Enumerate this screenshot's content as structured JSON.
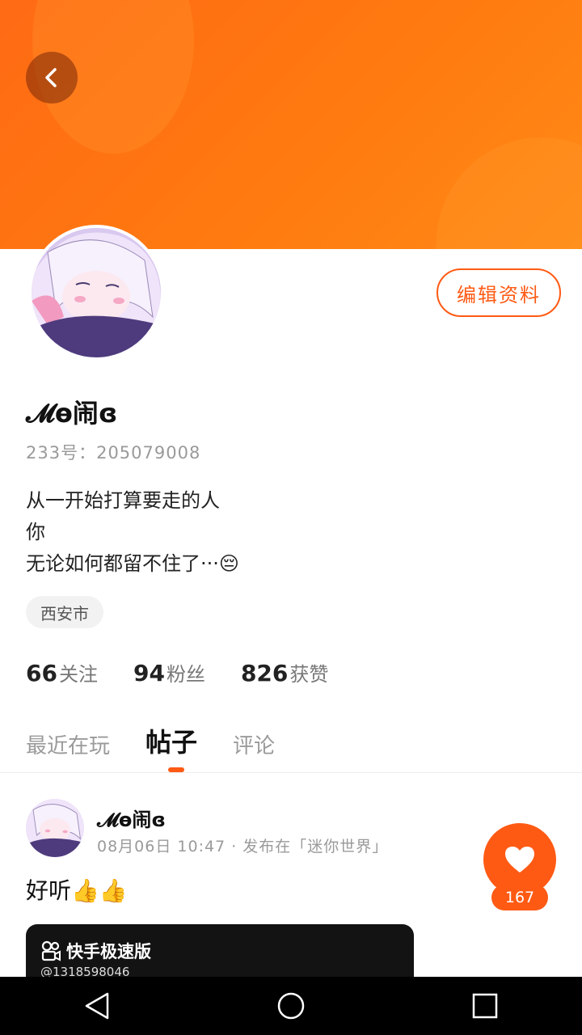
{
  "profile": {
    "edit_label": "编辑资料",
    "username": "𝓜ө闹ɞ",
    "uid_line": "233号：205079008",
    "bio_lines": [
      "从一开始打算要走的人",
      "你",
      "无论如何都留不住了···😔"
    ],
    "location": "西安市"
  },
  "stats": [
    {
      "value": "66",
      "label": "关注"
    },
    {
      "value": "94",
      "label": "粉丝"
    },
    {
      "value": "826",
      "label": "获赞"
    }
  ],
  "tabs": [
    {
      "label": "最近在玩",
      "active": false
    },
    {
      "label": "帖子",
      "active": true
    },
    {
      "label": "评论",
      "active": false
    }
  ],
  "post": {
    "author": "𝓜ө闹ɞ",
    "meta": "08月06日 10:47 · 发布在「迷你世界」",
    "text": "好听👍👍",
    "like_count": "167",
    "video": {
      "brand": "快手极速版",
      "handle": "@1318598046"
    }
  },
  "colors": {
    "accent": "#ff5a14",
    "banner": "#ff7a10"
  },
  "icons": {
    "back": "chevron-left-icon",
    "like": "heart-icon",
    "nav": [
      "back-triangle-icon",
      "home-circle-icon",
      "recents-square-icon"
    ]
  }
}
